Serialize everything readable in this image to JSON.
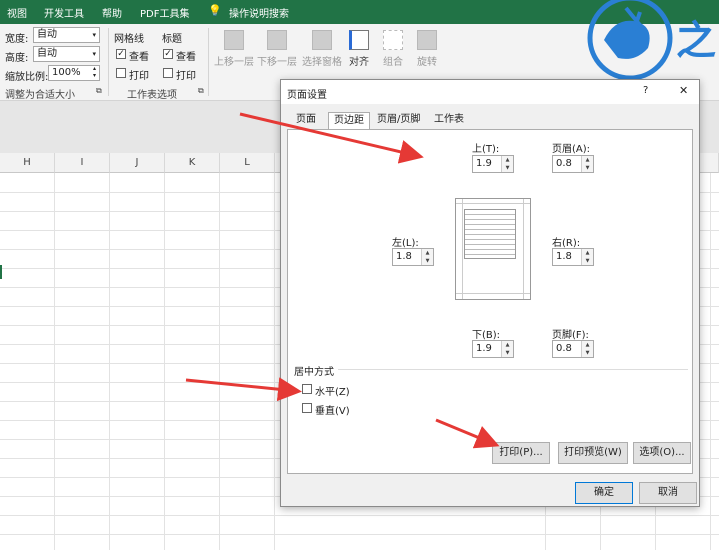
{
  "menubar": {
    "items": [
      "视图",
      "开发工具",
      "帮助",
      "PDF工具集",
      "操作说明搜索"
    ],
    "logo_text": "之"
  },
  "ribbon": {
    "width_label": "宽度:",
    "width_value": "自动",
    "height_label": "高度:",
    "height_value": "自动",
    "scale_label": "缩放比例:",
    "scale_value": "100%",
    "group_fit": "调整为合适大小",
    "gridlines_label": "网格线",
    "headings_label": "标题",
    "view_label": "查看",
    "print_label": "打印",
    "group_sheet": "工作表选项",
    "arrange": [
      "上移一层",
      "下移一层",
      "选择窗格",
      "对齐",
      "组合",
      "旋转"
    ]
  },
  "columns": [
    "H",
    "I",
    "J",
    "K",
    "L"
  ],
  "dialog": {
    "title": "页面设置",
    "help": "?",
    "close": "✕",
    "tabs": [
      "页面",
      "页边距",
      "页眉/页脚",
      "工作表"
    ],
    "top_label": "上(T):",
    "top_value": "1.9",
    "header_label": "页眉(A):",
    "header_value": "0.8",
    "left_label": "左(L):",
    "left_value": "1.8",
    "right_label": "右(R):",
    "right_value": "1.8",
    "bottom_label": "下(B):",
    "bottom_value": "1.9",
    "footer_label": "页脚(F):",
    "footer_value": "0.8",
    "center_title": "居中方式",
    "horizontal_label": "水平(Z)",
    "vertical_label": "垂直(V)",
    "print_btn": "打印(P)...",
    "preview_btn": "打印预览(W)",
    "options_btn": "选项(O)...",
    "ok_btn": "确定",
    "cancel_btn": "取消"
  },
  "colors": {
    "menubar": "#217346",
    "arrow": "#e53935",
    "logo": "#2a7fd4"
  },
  "icons": [
    "help-icon",
    "close-icon",
    "lightbulb-icon",
    "spin-arrows-icon",
    "arrow-annotation-icon"
  ]
}
